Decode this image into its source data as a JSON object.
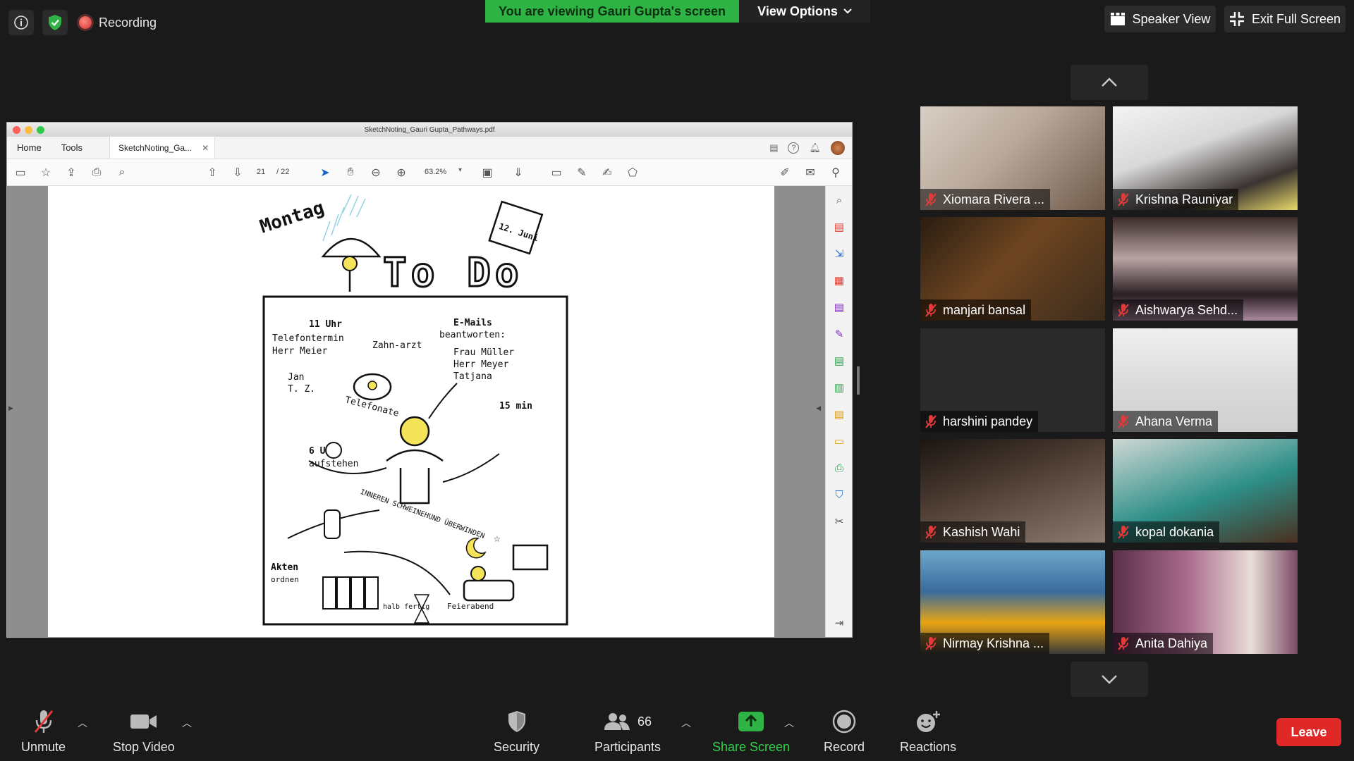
{
  "top": {
    "recording_label": "Recording",
    "viewing_banner": "You are viewing Gauri Gupta's screen",
    "view_options": "View Options",
    "speaker_view": "Speaker View",
    "exit_full_screen": "Exit Full Screen"
  },
  "pdf": {
    "window_title": "SketchNoting_Gauri Gupta_Pathways.pdf",
    "tabs": {
      "home": "Home",
      "tools": "Tools",
      "document": "SketchNoting_Ga..."
    },
    "page_current": "21",
    "page_total": "/ 22",
    "zoom": "63.2%",
    "sketch": {
      "heading_day": "Montag",
      "heading_todo": "To Do",
      "calendar": "12. Juni",
      "notes": [
        "11 Uhr",
        "Telefontermin",
        "Herr Meier",
        "Zahn-arzt",
        "E-Mails",
        "beantworten:",
        "Frau Müller",
        "Herr Meyer",
        "Tatjana",
        "Jan",
        "T. Z.",
        "Telefonate",
        "15 min",
        "6 Uhr",
        "aufstehen",
        "INNEREN SCHWEINEHUND ÜBERWINDEN",
        "Akten",
        "ordnen",
        "halb fertig",
        "Feierabend"
      ]
    }
  },
  "participants": [
    {
      "name": "Xiomara Rivera ..."
    },
    {
      "name": "Krishna Rauniyar"
    },
    {
      "name": "manjari bansal"
    },
    {
      "name": "Aishwarya Sehd..."
    },
    {
      "name": "harshini pandey"
    },
    {
      "name": "Ahana Verma"
    },
    {
      "name": "Kashish Wahi"
    },
    {
      "name": "kopal dokania"
    },
    {
      "name": "Nirmay Krishna ..."
    },
    {
      "name": "Anita Dahiya"
    }
  ],
  "bottom": {
    "unmute": "Unmute",
    "stop_video": "Stop Video",
    "security": "Security",
    "participants_label": "Participants",
    "participants_count": "66",
    "share_screen": "Share Screen",
    "record": "Record",
    "reactions": "Reactions",
    "leave": "Leave"
  },
  "colors": {
    "green": "#2fb344",
    "leave_red": "#e02828",
    "muted_red": "#e03a3a"
  }
}
